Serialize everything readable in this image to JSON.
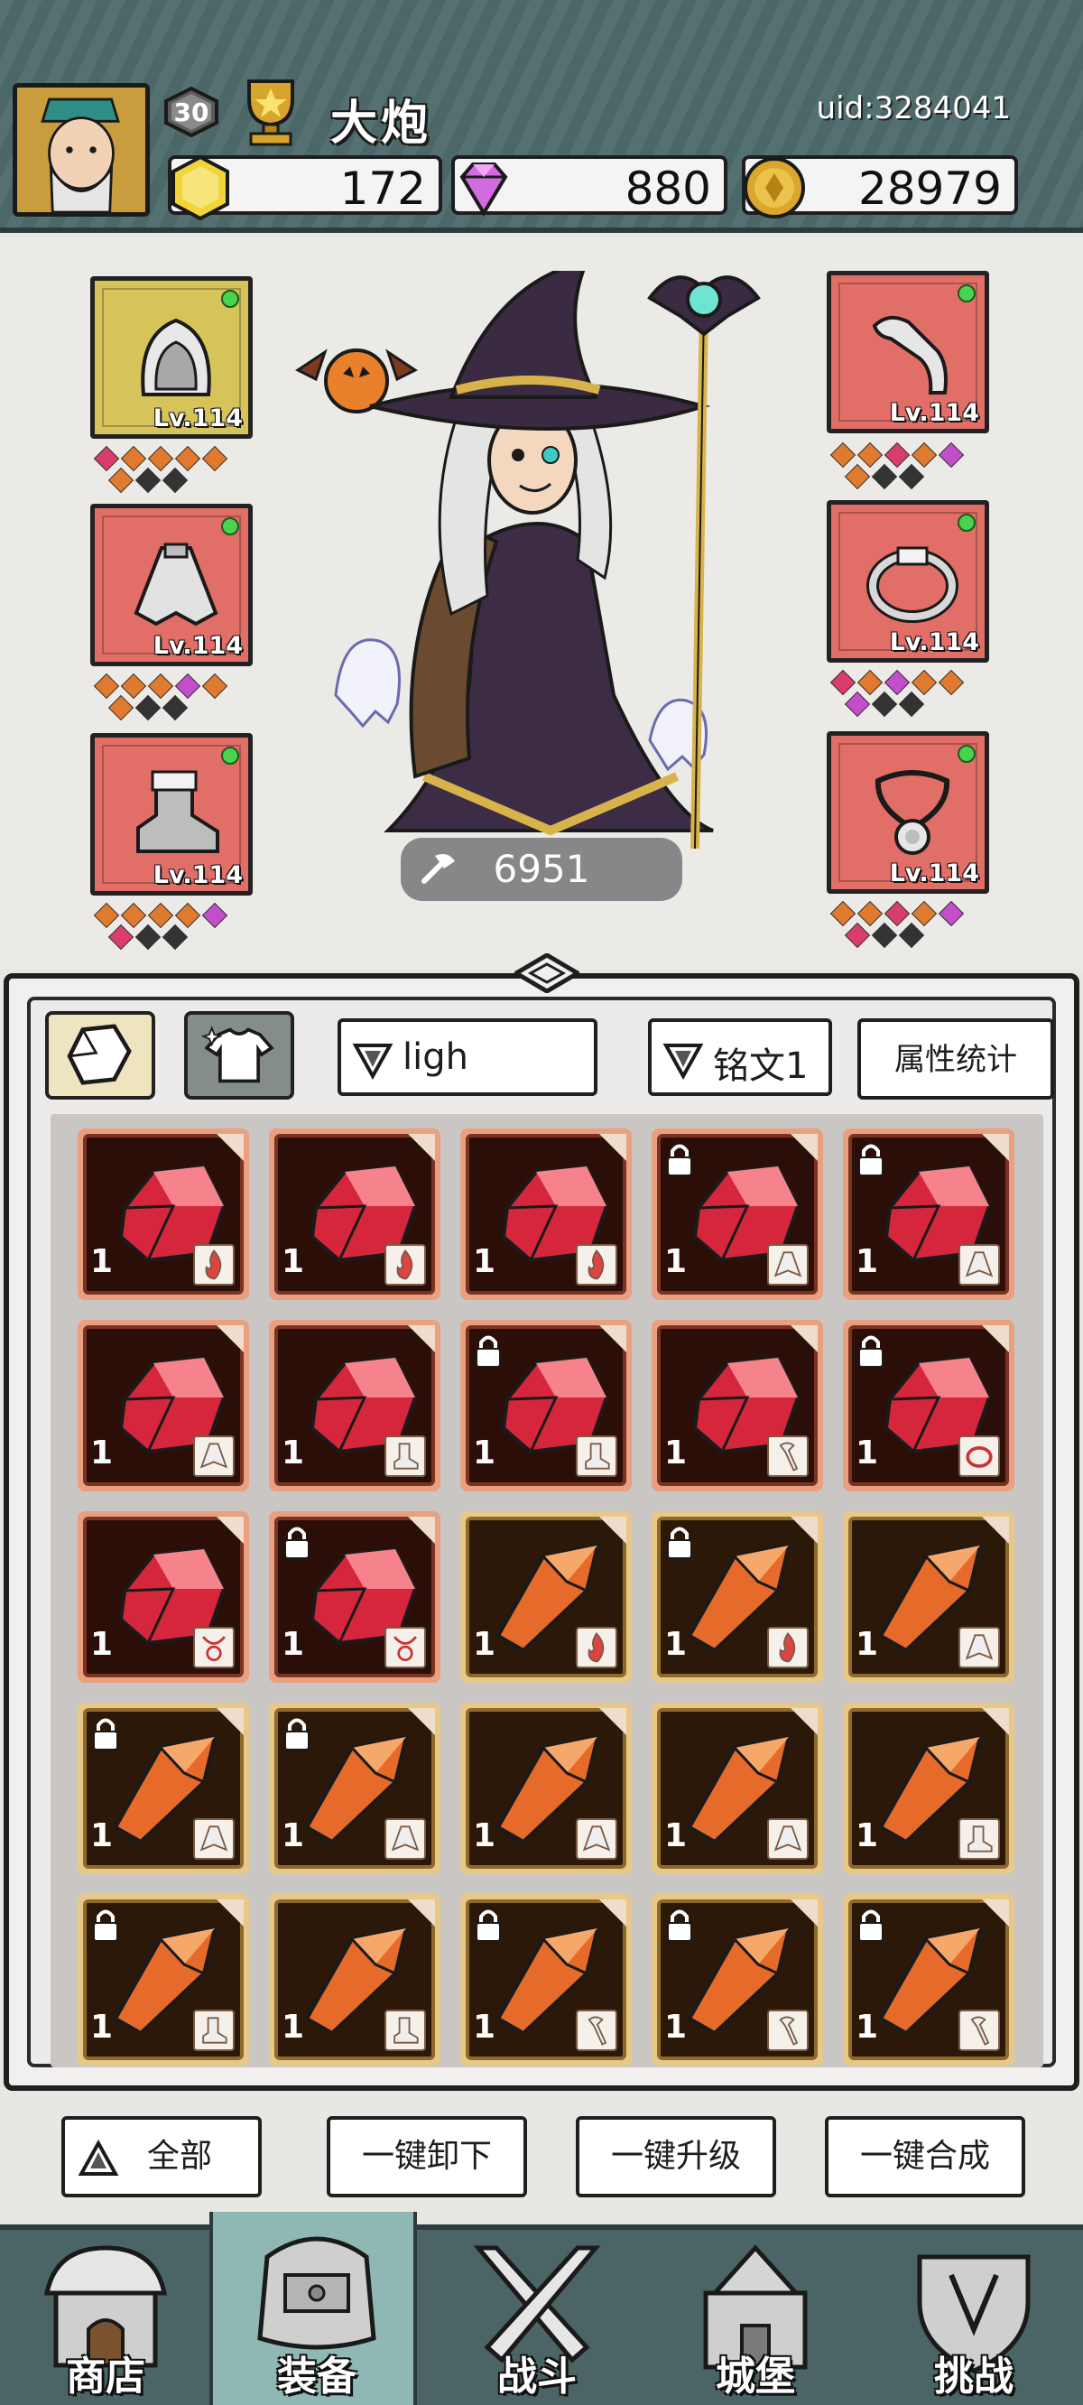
{
  "player": {
    "level": "30",
    "name": "大炮",
    "uid": "uid:3284041"
  },
  "currencies": [
    {
      "icon": "gold-hexagon-icon",
      "value": "172",
      "color": "#f1d43a"
    },
    {
      "icon": "diamond-icon",
      "value": "880",
      "color": "#d36be0"
    },
    {
      "icon": "coin-icon",
      "value": "28979",
      "color": "#d9a72c"
    }
  ],
  "equipment": {
    "slots": [
      {
        "id": "hood",
        "icon": "hood-icon",
        "level": "Lv.114",
        "rarity": "gold"
      },
      {
        "id": "cloak",
        "icon": "cloak-icon",
        "level": "Lv.114",
        "rarity": "red"
      },
      {
        "id": "boots",
        "icon": "boots-icon",
        "level": "Lv.114",
        "rarity": "red"
      },
      {
        "id": "bone",
        "icon": "bone-weapon-icon",
        "level": "Lv.114",
        "rarity": "red"
      },
      {
        "id": "ring",
        "icon": "ring-icon",
        "level": "Lv.114",
        "rarity": "red"
      },
      {
        "id": "amulet",
        "icon": "amulet-icon",
        "level": "Lv.114",
        "rarity": "red"
      }
    ],
    "combat_power": "6951"
  },
  "inventory": {
    "tabs": [
      {
        "icon": "rune-gem-tab-icon",
        "selected": true
      },
      {
        "icon": "shirt-tab-icon",
        "selected": false
      }
    ],
    "filter_1": "ligh",
    "filter_2": "铭文1",
    "stats_button": "属性统计",
    "items": [
      {
        "color": "red",
        "qty": "1",
        "locked": false,
        "type": "flame"
      },
      {
        "color": "red",
        "qty": "1",
        "locked": false,
        "type": "flame"
      },
      {
        "color": "red",
        "qty": "1",
        "locked": false,
        "type": "flame"
      },
      {
        "color": "red",
        "qty": "1",
        "locked": true,
        "type": "cloak"
      },
      {
        "color": "red",
        "qty": "1",
        "locked": true,
        "type": "cloak"
      },
      {
        "color": "red",
        "qty": "1",
        "locked": false,
        "type": "cloak"
      },
      {
        "color": "red",
        "qty": "1",
        "locked": false,
        "type": "boot"
      },
      {
        "color": "red",
        "qty": "1",
        "locked": true,
        "type": "boot"
      },
      {
        "color": "red",
        "qty": "1",
        "locked": false,
        "type": "staff"
      },
      {
        "color": "red",
        "qty": "1",
        "locked": true,
        "type": "ring"
      },
      {
        "color": "red",
        "qty": "1",
        "locked": false,
        "type": "amulet"
      },
      {
        "color": "red",
        "qty": "1",
        "locked": true,
        "type": "amulet"
      },
      {
        "color": "orange",
        "qty": "1",
        "locked": false,
        "type": "flame"
      },
      {
        "color": "orange",
        "qty": "1",
        "locked": true,
        "type": "flame"
      },
      {
        "color": "orange",
        "qty": "1",
        "locked": false,
        "type": "cloak"
      },
      {
        "color": "orange",
        "qty": "1",
        "locked": true,
        "type": "cloak"
      },
      {
        "color": "orange",
        "qty": "1",
        "locked": true,
        "type": "cloak"
      },
      {
        "color": "orange",
        "qty": "1",
        "locked": false,
        "type": "cloak"
      },
      {
        "color": "orange",
        "qty": "1",
        "locked": false,
        "type": "cloak"
      },
      {
        "color": "orange",
        "qty": "1",
        "locked": false,
        "type": "boot"
      },
      {
        "color": "orange",
        "qty": "1",
        "locked": true,
        "type": "boot"
      },
      {
        "color": "orange",
        "qty": "1",
        "locked": false,
        "type": "boot"
      },
      {
        "color": "orange",
        "qty": "1",
        "locked": true,
        "type": "staff"
      },
      {
        "color": "orange",
        "qty": "1",
        "locked": true,
        "type": "staff"
      },
      {
        "color": "orange",
        "qty": "1",
        "locked": true,
        "type": "staff"
      }
    ]
  },
  "actions": {
    "all": "全部",
    "unequip_all": "一键卸下",
    "upgrade_all": "一键升级",
    "merge_all": "一键合成"
  },
  "nav": [
    {
      "label": "商店",
      "icon": "shop-icon",
      "active": false
    },
    {
      "label": "装备",
      "icon": "backpack-icon",
      "active": true
    },
    {
      "label": "战斗",
      "icon": "crossed-swords-icon",
      "active": false
    },
    {
      "label": "城堡",
      "icon": "castle-icon",
      "active": false
    },
    {
      "label": "挑战",
      "icon": "challenge-shield-icon",
      "active": false
    }
  ]
}
